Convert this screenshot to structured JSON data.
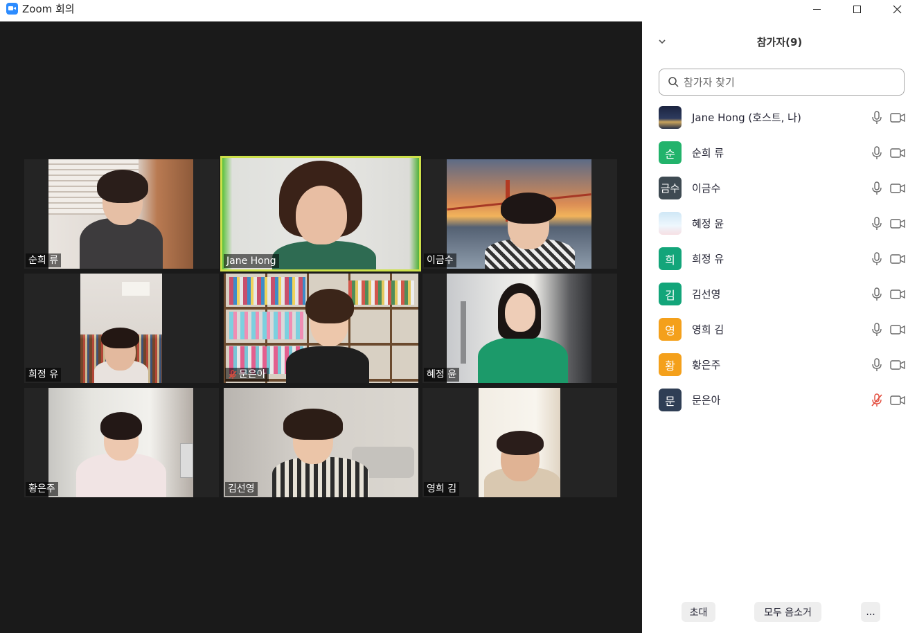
{
  "window": {
    "title": "Zoom 회의"
  },
  "gallery": [
    {
      "name": "순희 류",
      "muted": false,
      "active": false
    },
    {
      "name": "Jane Hong",
      "muted": false,
      "active": true
    },
    {
      "name": "이금수",
      "muted": false,
      "active": false
    },
    {
      "name": "희정 유",
      "muted": false,
      "active": false
    },
    {
      "name": "문은아",
      "muted": true,
      "active": false
    },
    {
      "name": "혜정 윤",
      "muted": false,
      "active": false
    },
    {
      "name": "황은주",
      "muted": false,
      "active": false
    },
    {
      "name": "김선영",
      "muted": false,
      "active": false
    },
    {
      "name": "영희 김",
      "muted": false,
      "active": false
    }
  ],
  "panel": {
    "title": "참가자(9)",
    "search_placeholder": "참가자 찾기",
    "participants": [
      {
        "name": "Jane Hong (호스트, 나)",
        "avatar_text": "",
        "avatar_color": "#2a3550",
        "muted": false
      },
      {
        "name": "순희 류",
        "avatar_text": "순",
        "avatar_color": "#22b36b",
        "muted": false
      },
      {
        "name": "이금수",
        "avatar_text": "금수",
        "avatar_color": "#3e4a52",
        "muted": false
      },
      {
        "name": "혜정 윤",
        "avatar_text": "",
        "avatar_color": "#bfe0f2",
        "muted": false
      },
      {
        "name": "희정 유",
        "avatar_text": "희",
        "avatar_color": "#13a57a",
        "muted": false
      },
      {
        "name": "김선영",
        "avatar_text": "김",
        "avatar_color": "#13a57a",
        "muted": false
      },
      {
        "name": "영희 김",
        "avatar_text": "영",
        "avatar_color": "#f4a01b",
        "muted": false
      },
      {
        "name": "황은주",
        "avatar_text": "황",
        "avatar_color": "#f4a01b",
        "muted": false
      },
      {
        "name": "문은아",
        "avatar_text": "문",
        "avatar_color": "#2f3e55",
        "muted": true
      }
    ],
    "buttons": {
      "invite": "초대",
      "mute_all": "모두 음소거",
      "more": "..."
    }
  }
}
